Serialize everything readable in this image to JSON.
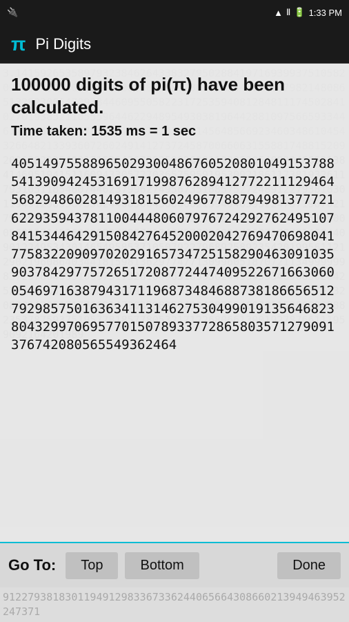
{
  "statusBar": {
    "leftIcon": "usb-icon",
    "wifiIcon": "wifi-icon",
    "signalIcon": "signal-icon",
    "batteryIcon": "battery-icon",
    "time": "1:33 PM"
  },
  "titleBar": {
    "piSymbol": "π",
    "title": "Pi Digits"
  },
  "main": {
    "digitsCountText": "100000 digits of pi(π) have been calculated.",
    "timeTakenText": "Time taken: 1535 ms = 1 sec",
    "digits": "40514975588965029300486760520801049153788541390942453169171998762894127722111294645682948602814931815602496778879498137772162293594378110044480607976724292762495107841534464291508427645200020427694706980417758322090970202916573472515829046309103590378429775726517208772447409522671663060054697163879431711968734846887381866565127929857501636341131462753049901913564682380432997069577015078933772865803571279091376742080565549362464"
  },
  "footer": {
    "goToLabel": "Go To:",
    "topButton": "Top",
    "bottomButton": "Bottom",
    "doneButton": "Done"
  },
  "bgDigits": "3.14159265358979323846264338327950288419716939937510582097494459230781640628620899862803482534211706798214808651328230664709384460955058223172535940812848111745028410270193852110555964462294895493038196442881097566593344612847564823378678316527120190914564856692346034861045432664821339360726024914127372458700660631558817488152092096282925409171536436789259036001133053054882046652138414695194151160943305727036575959195309218611738193261179310511854807446237996274956735188575272489122793818301194912983367336244065664308660213949463952247371907021798609437027705392171762931767523846748184676694051320005681271452635608277857713427577896091736371787214684409012249534301465495853710507922796892589235420199561121290219608640344181598136297747713099605187072113499999983729780499510597317328160963185950244594553469083026425223082533446850352619311881710100031378387528865875332083814206171776691473035982534904287554687311595628638823537875937519577818577805321712268066130019278766111959092164201989",
  "belowDigits": "9122793818301194912983367336244065664308660213949463952247371"
}
